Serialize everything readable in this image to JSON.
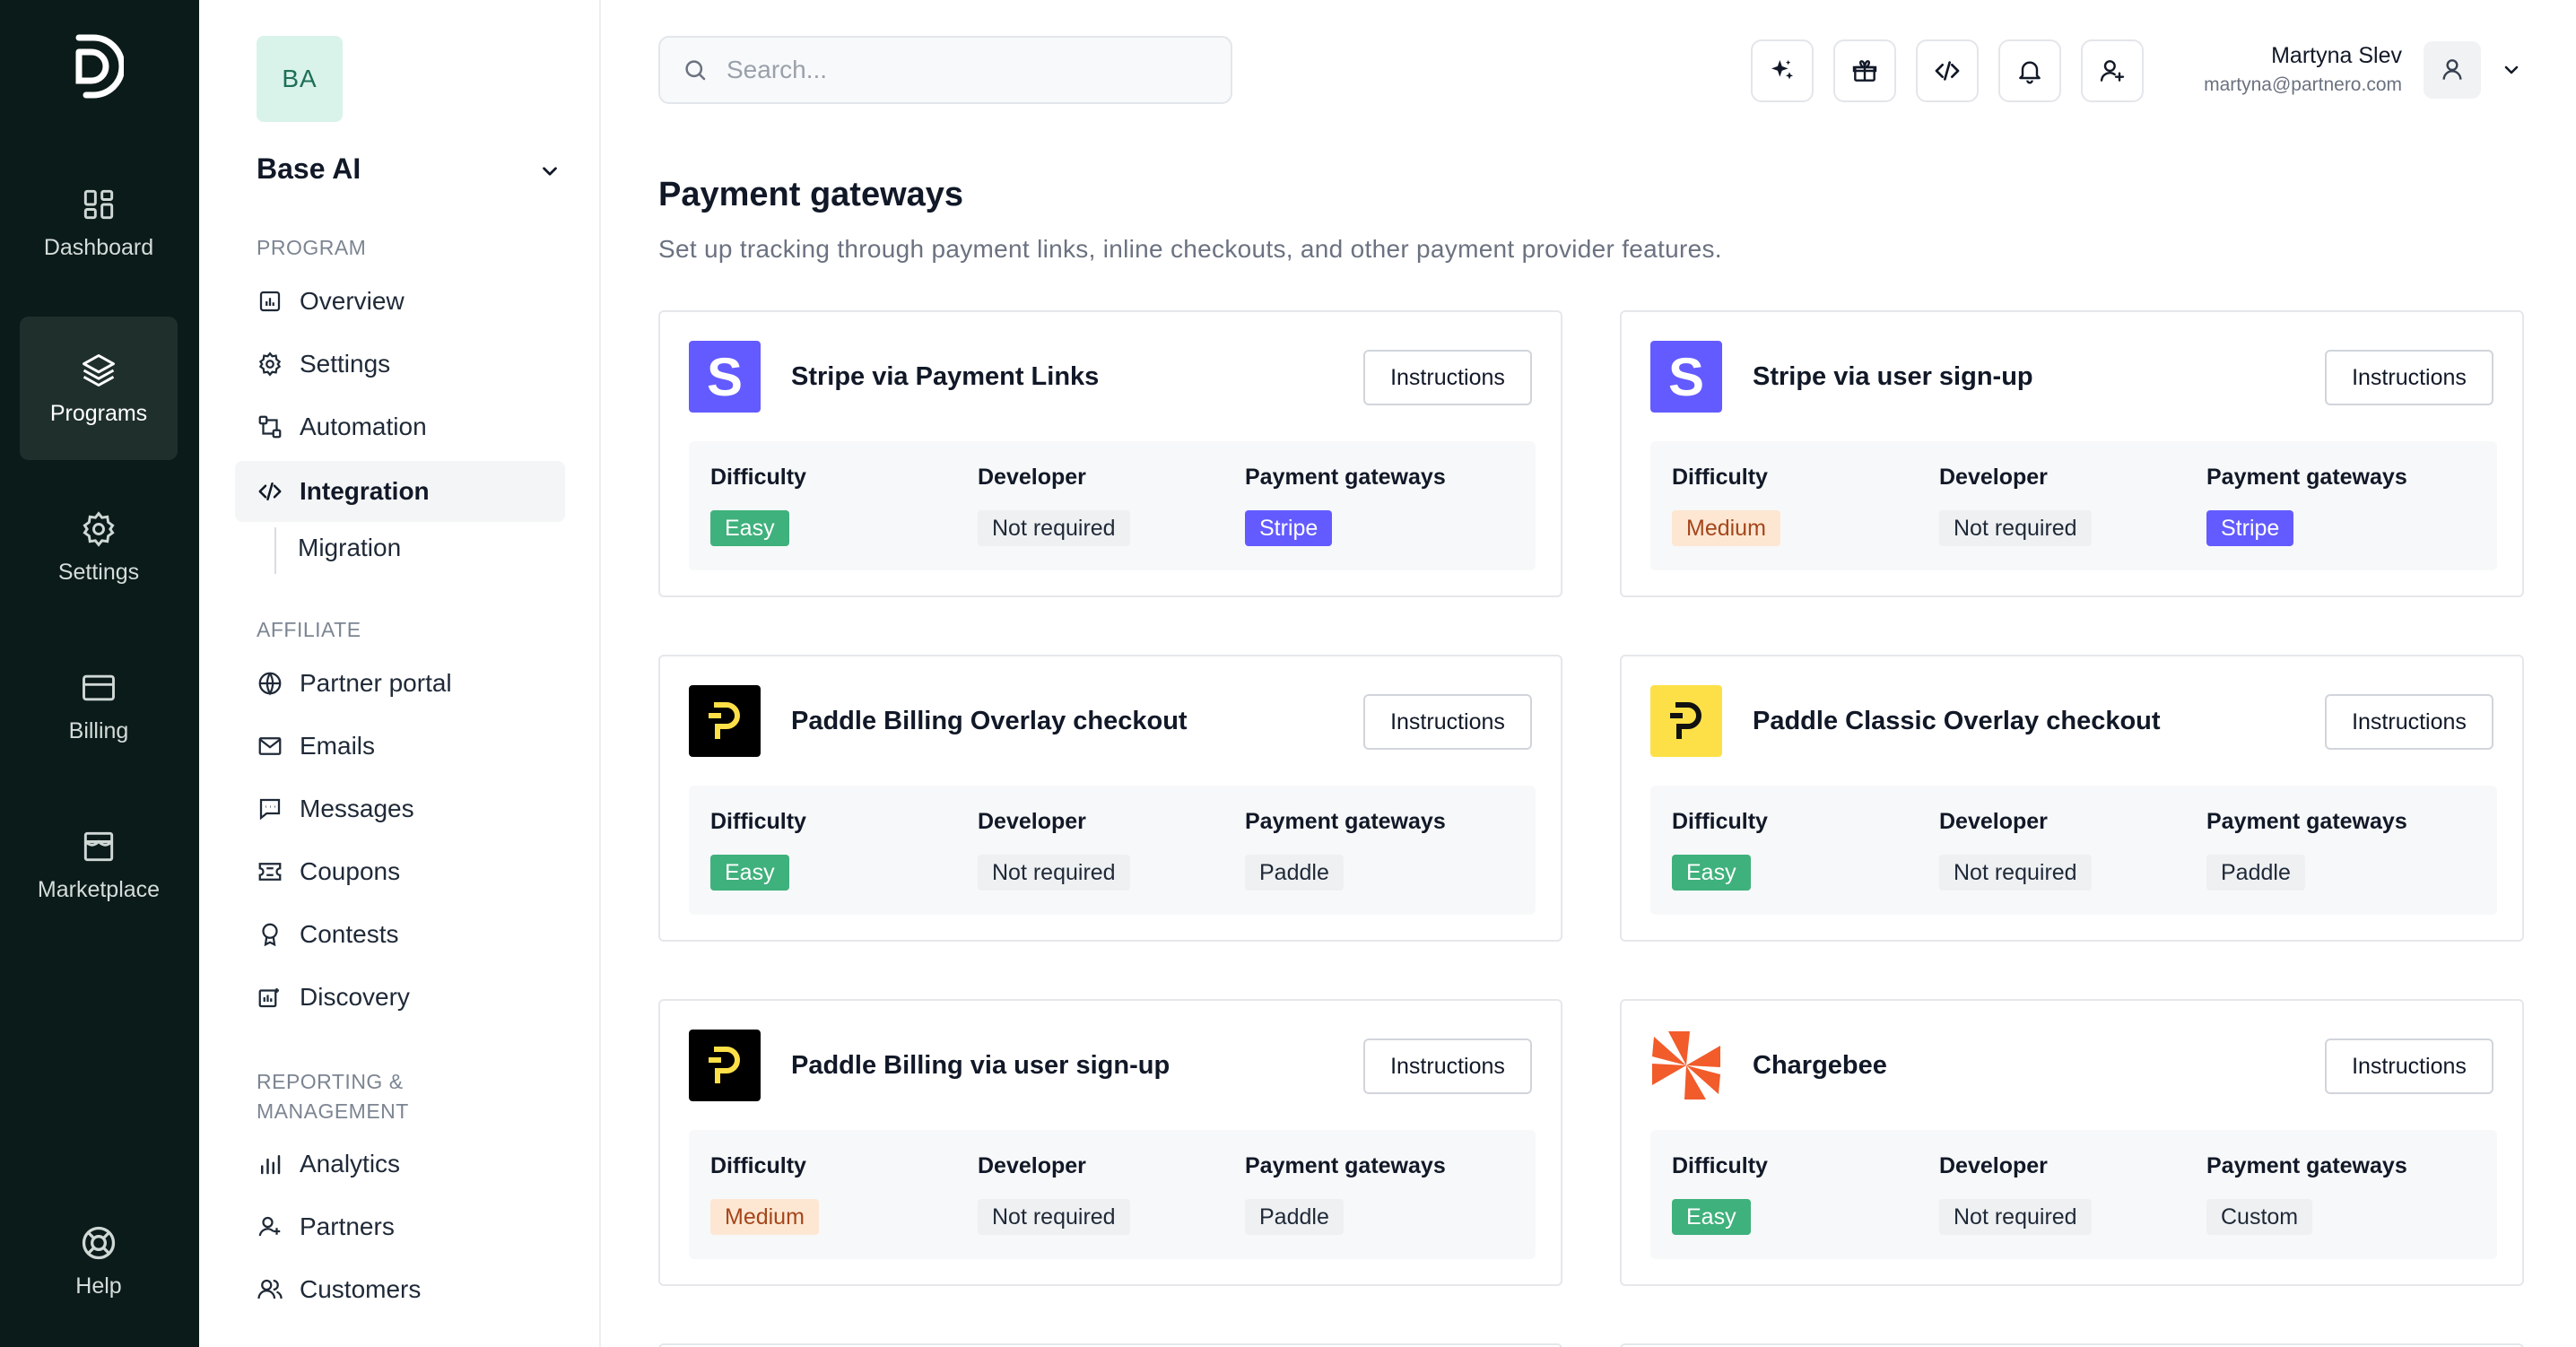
{
  "rail": {
    "items": [
      {
        "label": "Dashboard",
        "icon": "dashboard-icon"
      },
      {
        "label": "Programs",
        "icon": "layers-icon",
        "active": true
      },
      {
        "label": "Settings",
        "icon": "gear-icon"
      },
      {
        "label": "Billing",
        "icon": "wallet-icon"
      },
      {
        "label": "Marketplace",
        "icon": "store-icon"
      }
    ],
    "help_label": "Help"
  },
  "sidebar": {
    "org_initials": "BA",
    "org_name": "Base AI",
    "section_program": "PROGRAM",
    "program_items": [
      "Overview",
      "Settings",
      "Automation",
      "Integration"
    ],
    "sub_item": "Migration",
    "section_affiliate": "AFFILIATE",
    "affiliate_items": [
      "Partner portal",
      "Emails",
      "Messages",
      "Coupons",
      "Contests",
      "Discovery"
    ],
    "section_reporting_line1": "REPORTING &",
    "section_reporting_line2": "MANAGEMENT",
    "reporting_items": [
      "Analytics",
      "Partners",
      "Customers"
    ]
  },
  "header": {
    "search_placeholder": "Search...",
    "user_name": "Martyna Slev",
    "user_email": "martyna@partnero.com"
  },
  "main": {
    "title": "Payment gateways",
    "subtitle": "Set up tracking through payment links, inline checkouts, and other payment provider features.",
    "labels": {
      "difficulty": "Difficulty",
      "developer": "Developer",
      "gateways": "Payment gateways",
      "instructions": "Instructions"
    },
    "cards": [
      {
        "title": "Stripe via Payment Links",
        "difficulty": "Easy",
        "developer": "Not required",
        "gateway": "Stripe"
      },
      {
        "title": "Stripe via user sign-up",
        "difficulty": "Medium",
        "developer": "Not required",
        "gateway": "Stripe"
      },
      {
        "title": "Paddle Billing Overlay checkout",
        "difficulty": "Easy",
        "developer": "Not required",
        "gateway": "Paddle"
      },
      {
        "title": "Paddle Classic Overlay checkout",
        "difficulty": "Easy",
        "developer": "Not required",
        "gateway": "Paddle"
      },
      {
        "title": "Paddle Billing via user sign-up",
        "difficulty": "Medium",
        "developer": "Not required",
        "gateway": "Paddle"
      },
      {
        "title": "Chargebee",
        "difficulty": "Easy",
        "developer": "Not required",
        "gateway": "Custom"
      }
    ]
  },
  "colors": {
    "rail_bg": "#0b1b19",
    "easy": "#3fb17c",
    "medium_bg": "#fde7d3",
    "stripe": "#635bff",
    "paddle_yellow": "#fde047",
    "chargebee": "#f25b2a"
  }
}
